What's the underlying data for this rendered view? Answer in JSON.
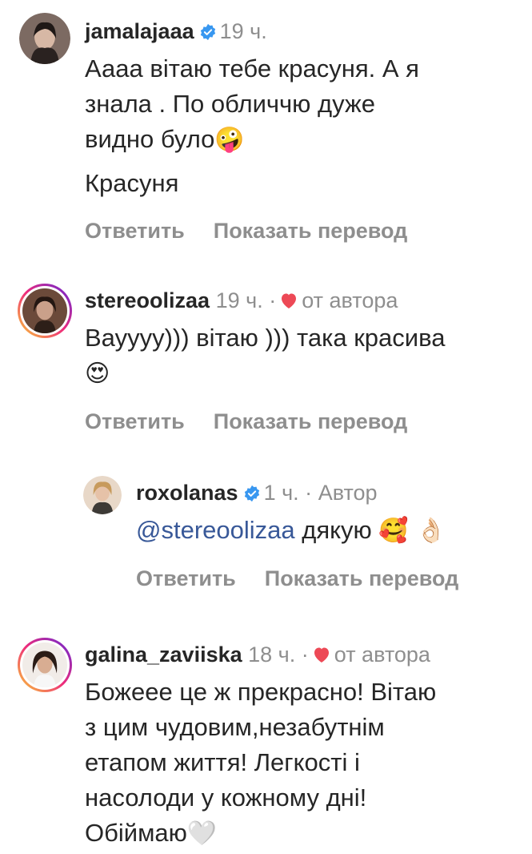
{
  "comments": [
    {
      "username": "jamalajaaa",
      "verified": true,
      "time": "19 ч.",
      "lines": [
        "Аааа вітаю тебе красуня. А я",
        "знала . По обличчю дуже",
        "видно було"
      ],
      "emoji_after": "🤪",
      "extra_line": "Красуня",
      "reply_label": "Ответить",
      "translate_label": "Показать перевод"
    },
    {
      "username": "stereoolizaa",
      "time": "19 ч.",
      "separator": "·",
      "author_like": "от автора",
      "lines": [
        "Вауууу))) вітаю ))) така красива"
      ],
      "emoji_line": "😍",
      "reply_label": "Ответить",
      "translate_label": "Показать перевод"
    },
    {
      "username": "roxolanas",
      "verified": true,
      "time": "1 ч.",
      "separator": "·",
      "author_tag": "Автор",
      "mention": "@stereoolizaa",
      "text": " дякую ",
      "emojis": "🥰 👌🏻",
      "reply_label": "Ответить",
      "translate_label": "Показать перевод"
    },
    {
      "username": "galina_zaviiska",
      "time": "18 ч.",
      "separator": "·",
      "author_like": "от автора",
      "lines": [
        "Божеее це ж прекрасно! Вітаю",
        "з цим чудовим,незабутнім",
        "етапом життя! Легкості і",
        "насолоди у кожному дні!",
        "Обіймаю"
      ],
      "emoji_after": "🤍"
    }
  ],
  "colors": {
    "verified": "#3897f0",
    "heart": "#ed4956",
    "muted": "#8e8e8e",
    "mention": "#385898"
  }
}
